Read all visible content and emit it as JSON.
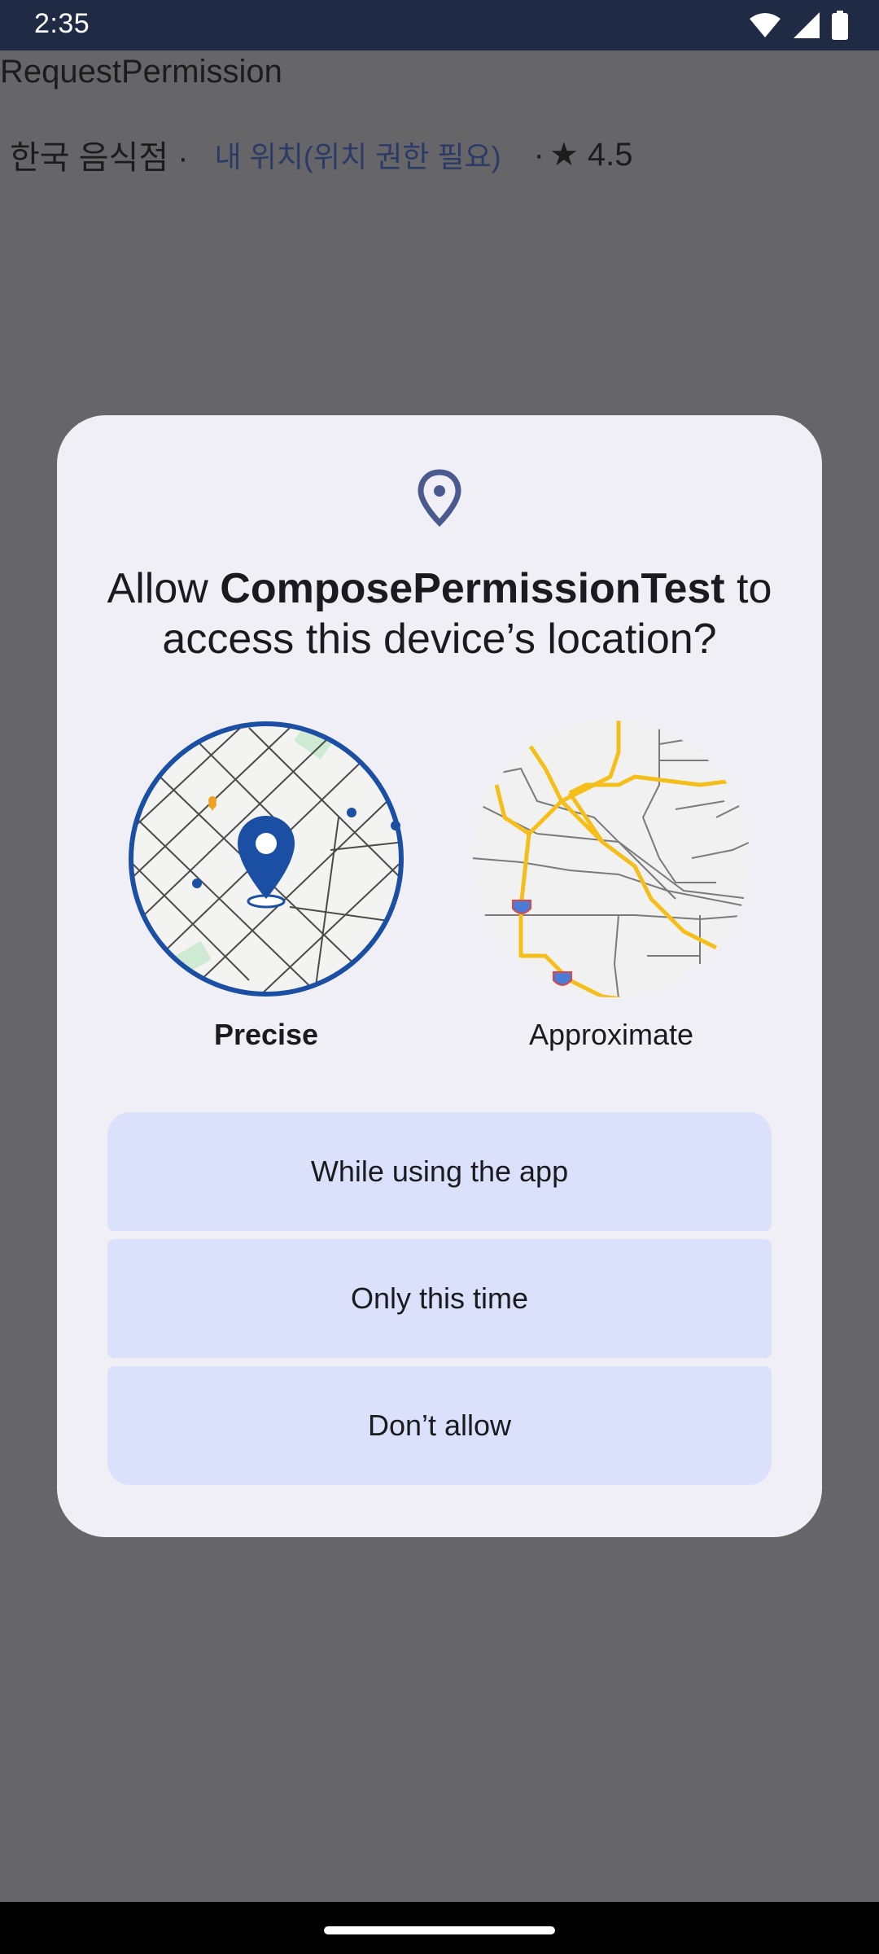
{
  "status_bar": {
    "time": "2:35",
    "icons": [
      "wifi-icon",
      "cell-signal-icon",
      "battery-icon"
    ]
  },
  "app": {
    "title": "RequestPermission",
    "restaurant_type": "한국 음식점 ·",
    "location_link": "내 위치(위치 권한 필요)",
    "rating_separator": "·",
    "rating": "★ 4.5"
  },
  "dialog": {
    "icon": "location-pin-icon",
    "title_prefix": "Allow ",
    "app_name": "ComposePermissionTest",
    "title_suffix": " to access this device’s location?",
    "options": {
      "precise_label": "Precise",
      "approximate_label": "Approximate",
      "selected": "Precise"
    },
    "buttons": {
      "while_using": "While using the app",
      "only_this_time": "Only this time",
      "dont_allow": "Don’t allow"
    }
  },
  "colors": {
    "status_bar": "#1f2a44",
    "scrim": "#666668",
    "dialog_bg": "#f1eff6",
    "button_bg": "#dce1fb",
    "accent_blue": "#1a4fa3",
    "road_yellow": "#f5bf1b"
  }
}
